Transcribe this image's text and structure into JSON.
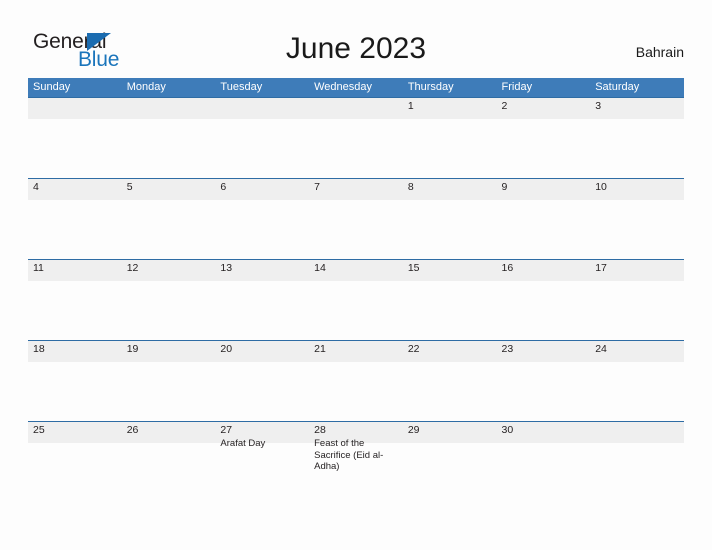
{
  "brand": {
    "name_part1": "General",
    "name_part2": "Blue",
    "accent_color": "#1b6cb0"
  },
  "header": {
    "title": "June 2023",
    "subtitle": "Bahrain"
  },
  "calendar": {
    "header_color": "#3e7cb9",
    "band_color": "#efefef",
    "band_border_color": "#2e6ca4",
    "weekdays": [
      "Sunday",
      "Monday",
      "Tuesday",
      "Wednesday",
      "Thursday",
      "Friday",
      "Saturday"
    ],
    "weeks": [
      [
        {
          "day": "",
          "event": ""
        },
        {
          "day": "",
          "event": ""
        },
        {
          "day": "",
          "event": ""
        },
        {
          "day": "",
          "event": ""
        },
        {
          "day": "1",
          "event": ""
        },
        {
          "day": "2",
          "event": ""
        },
        {
          "day": "3",
          "event": ""
        }
      ],
      [
        {
          "day": "4",
          "event": ""
        },
        {
          "day": "5",
          "event": ""
        },
        {
          "day": "6",
          "event": ""
        },
        {
          "day": "7",
          "event": ""
        },
        {
          "day": "8",
          "event": ""
        },
        {
          "day": "9",
          "event": ""
        },
        {
          "day": "10",
          "event": ""
        }
      ],
      [
        {
          "day": "11",
          "event": ""
        },
        {
          "day": "12",
          "event": ""
        },
        {
          "day": "13",
          "event": ""
        },
        {
          "day": "14",
          "event": ""
        },
        {
          "day": "15",
          "event": ""
        },
        {
          "day": "16",
          "event": ""
        },
        {
          "day": "17",
          "event": ""
        }
      ],
      [
        {
          "day": "18",
          "event": ""
        },
        {
          "day": "19",
          "event": ""
        },
        {
          "day": "20",
          "event": ""
        },
        {
          "day": "21",
          "event": ""
        },
        {
          "day": "22",
          "event": ""
        },
        {
          "day": "23",
          "event": ""
        },
        {
          "day": "24",
          "event": ""
        }
      ],
      [
        {
          "day": "25",
          "event": ""
        },
        {
          "day": "26",
          "event": ""
        },
        {
          "day": "27",
          "event": "Arafat Day"
        },
        {
          "day": "28",
          "event": "Feast of the Sacrifice (Eid al-Adha)"
        },
        {
          "day": "29",
          "event": ""
        },
        {
          "day": "30",
          "event": ""
        },
        {
          "day": "",
          "event": ""
        }
      ]
    ]
  }
}
